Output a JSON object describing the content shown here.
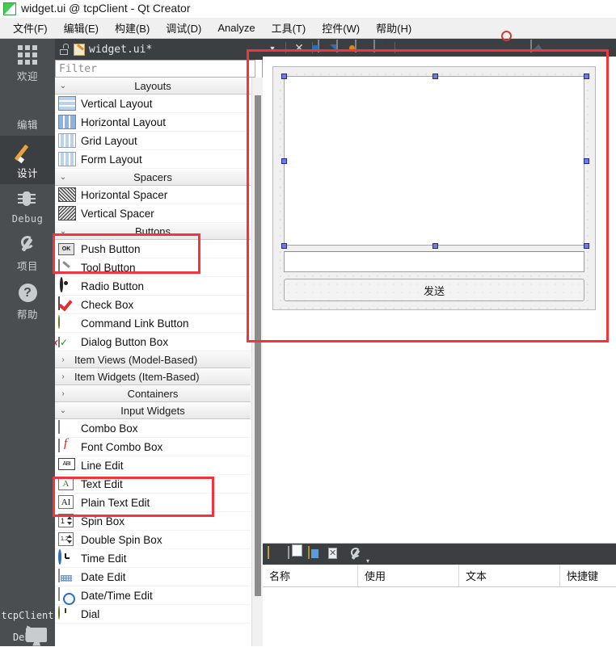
{
  "window": {
    "title": "widget.ui @ tcpClient - Qt Creator",
    "app_icon": "qt-logo-icon"
  },
  "menubar": {
    "items": [
      {
        "label": "文件(F)",
        "mnemonic": "F"
      },
      {
        "label": "编辑(E)",
        "mnemonic": "E"
      },
      {
        "label": "构建(B)",
        "mnemonic": "B"
      },
      {
        "label": "调试(D)",
        "mnemonic": "D"
      },
      {
        "label": "Analyze",
        "mnemonic": "A"
      },
      {
        "label": "工具(T)",
        "mnemonic": "T"
      },
      {
        "label": "控件(W)",
        "mnemonic": "W"
      },
      {
        "label": "帮助(H)",
        "mnemonic": "H"
      }
    ]
  },
  "modebar": {
    "items": [
      {
        "label": "欢迎",
        "icon": "grid-icon",
        "active": false
      },
      {
        "label": "编辑",
        "icon": "document-icon",
        "active": false
      },
      {
        "label": "设计",
        "icon": "pencil-icon",
        "active": true
      },
      {
        "label": "Debug",
        "icon": "bug-icon",
        "active": false
      },
      {
        "label": "项目",
        "icon": "wrench-icon",
        "active": false
      },
      {
        "label": "帮助",
        "icon": "question-circle-icon",
        "active": false
      }
    ],
    "kit": {
      "project": "tcpClient",
      "icon": "monitor-icon",
      "build_config": "Debug",
      "arrow": "▸"
    }
  },
  "editor_tab": {
    "lock_icon": "unlocked-icon",
    "file_icon": "ui-file-icon",
    "filename": "widget.ui*",
    "dropdown_icon": "chevron-down-icon",
    "close_icon": "close-icon"
  },
  "widgetbox": {
    "filter": {
      "value": "",
      "placeholder": "Filter"
    },
    "groups": [
      {
        "name": "Layouts",
        "expanded": true,
        "align": "center",
        "items": [
          {
            "label": "Vertical Layout",
            "icon": "vertical-layout-icon"
          },
          {
            "label": "Horizontal Layout",
            "icon": "horizontal-layout-icon"
          },
          {
            "label": "Grid Layout",
            "icon": "grid-layout-icon"
          },
          {
            "label": "Form Layout",
            "icon": "form-layout-icon"
          }
        ]
      },
      {
        "name": "Spacers",
        "expanded": true,
        "align": "center",
        "items": [
          {
            "label": "Horizontal Spacer",
            "icon": "horizontal-spacer-icon"
          },
          {
            "label": "Vertical Spacer",
            "icon": "vertical-spacer-icon"
          }
        ]
      },
      {
        "name": "Buttons",
        "expanded": true,
        "align": "center",
        "items": [
          {
            "label": "Push Button",
            "icon": "push-button-icon"
          },
          {
            "label": "Tool Button",
            "icon": "tool-button-icon"
          },
          {
            "label": "Radio Button",
            "icon": "radio-button-icon"
          },
          {
            "label": "Check Box",
            "icon": "check-box-icon"
          },
          {
            "label": "Command Link Button",
            "icon": "command-link-button-icon"
          },
          {
            "label": "Dialog Button Box",
            "icon": "dialog-button-box-icon"
          }
        ]
      },
      {
        "name": "Item Views (Model-Based)",
        "expanded": false,
        "align": "left",
        "items": []
      },
      {
        "name": "Item Widgets (Item-Based)",
        "expanded": false,
        "align": "left",
        "items": []
      },
      {
        "name": "Containers",
        "expanded": false,
        "align": "center",
        "items": []
      },
      {
        "name": "Input Widgets",
        "expanded": true,
        "align": "center",
        "items": [
          {
            "label": "Combo Box",
            "icon": "combo-box-icon"
          },
          {
            "label": "Font Combo Box",
            "icon": "font-combo-box-icon"
          },
          {
            "label": "Line Edit",
            "icon": "line-edit-icon"
          },
          {
            "label": "Text Edit",
            "icon": "text-edit-icon"
          },
          {
            "label": "Plain Text Edit",
            "icon": "plain-text-edit-icon"
          },
          {
            "label": "Spin Box",
            "icon": "spin-box-icon"
          },
          {
            "label": "Double Spin Box",
            "icon": "double-spin-box-icon"
          },
          {
            "label": "Time Edit",
            "icon": "time-edit-icon"
          },
          {
            "label": "Date Edit",
            "icon": "date-edit-icon"
          },
          {
            "label": "Date/Time Edit",
            "icon": "date-time-edit-icon"
          },
          {
            "label": "Dial",
            "icon": "dial-icon"
          }
        ]
      }
    ]
  },
  "designer_toolbar": {
    "buttons": [
      {
        "icon": "chevron-down-icon",
        "name": "tab-dropdown"
      },
      {
        "icon": "close-icon",
        "name": "close-document"
      },
      {
        "icon": "edit-widgets-icon",
        "name": "edit-widgets"
      },
      {
        "icon": "edit-signals-slots-icon",
        "name": "edit-signals-slots"
      },
      {
        "icon": "edit-buddies-icon",
        "name": "edit-buddies"
      },
      {
        "icon": "edit-tab-order-icon",
        "name": "edit-tab-order"
      },
      {
        "icon": "layout-horizontally-icon",
        "name": "layout-horizontally"
      },
      {
        "icon": "layout-vertically-icon",
        "name": "layout-vertically"
      },
      {
        "icon": "layout-splitter-horizontal-icon",
        "name": "layout-splitter-horizontal"
      },
      {
        "icon": "layout-splitter-vertical-icon",
        "name": "layout-splitter-vertical"
      },
      {
        "icon": "layout-form-icon",
        "name": "layout-in-form"
      },
      {
        "icon": "layout-grid-icon",
        "name": "layout-in-grid"
      },
      {
        "icon": "break-layout-icon",
        "name": "break-layout"
      },
      {
        "icon": "adjust-size-icon",
        "name": "adjust-size"
      }
    ]
  },
  "form": {
    "widgets": [
      {
        "type": "text-edit",
        "name": "textEdit",
        "selected": true,
        "text": ""
      },
      {
        "type": "line-edit",
        "name": "lineEdit",
        "selected": false,
        "text": ""
      },
      {
        "type": "push-button",
        "name": "pushButton",
        "selected": false,
        "text": "发送"
      }
    ]
  },
  "action_editor": {
    "toolbar": [
      {
        "icon": "new-action-icon",
        "name": "new-action"
      },
      {
        "icon": "copy-icon",
        "name": "copy-action"
      },
      {
        "icon": "paste-icon",
        "name": "paste-action"
      },
      {
        "icon": "delete-icon",
        "name": "delete-action"
      },
      {
        "icon": "configure-icon",
        "name": "configure-action"
      }
    ],
    "columns": [
      "名称",
      "使用",
      "文本",
      "快捷键"
    ],
    "rows": []
  },
  "annotations": {
    "color": "#f4333d",
    "boxes": [
      {
        "name": "buttons-group-highlight",
        "target": "Buttons / Push Button"
      },
      {
        "name": "line-text-edit-highlight",
        "target": "Line Edit / Text Edit"
      },
      {
        "name": "form-canvas-highlight",
        "target": "Form design canvas"
      }
    ]
  }
}
